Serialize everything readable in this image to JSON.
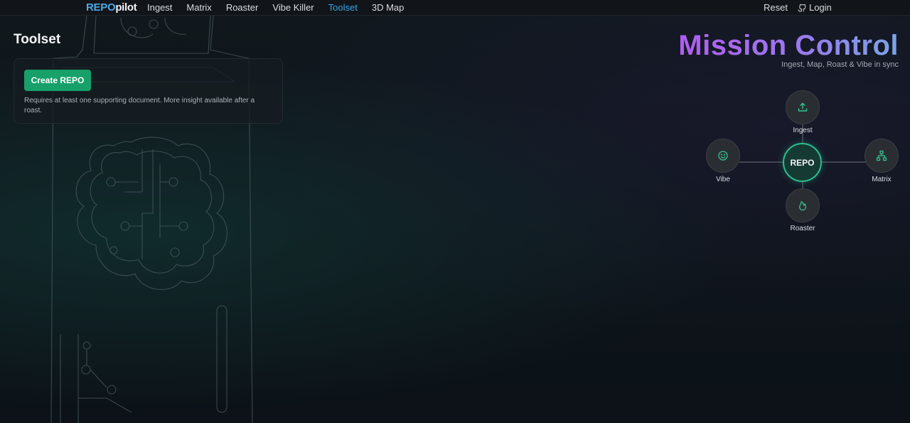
{
  "navbar": {
    "brand_part1": "REPO",
    "brand_part2": "pilot",
    "links": [
      {
        "label": "Ingest"
      },
      {
        "label": "Matrix"
      },
      {
        "label": "Roaster"
      },
      {
        "label": "Vibe Killer"
      },
      {
        "label": "Toolset",
        "active": true
      },
      {
        "label": "3D Map"
      }
    ],
    "reset_label": "Reset",
    "login_label": "Login",
    "login_icon": "github-icon"
  },
  "toolset": {
    "title": "Toolset",
    "create_button_label": "Create REPO",
    "note": "Requires at least one supporting document. More insight available after a roast."
  },
  "mission_control": {
    "title": "Mission Control",
    "subtitle": "Ingest, Map, Roast & Vibe in sync",
    "center_label": "REPO",
    "nodes": {
      "ingest": {
        "label": "Ingest",
        "icon": "upload-icon"
      },
      "vibe": {
        "label": "Vibe",
        "icon": "smiley-icon"
      },
      "matrix": {
        "label": "Matrix",
        "icon": "network-icon"
      },
      "roaster": {
        "label": "Roaster",
        "icon": "flame-icon"
      }
    }
  },
  "colors": {
    "accent_blue": "#3aa7e8",
    "button_green": "#17a06a",
    "node_green": "#2bbd8e",
    "title_purple": "#b25cf2",
    "background": "#0d1419"
  }
}
